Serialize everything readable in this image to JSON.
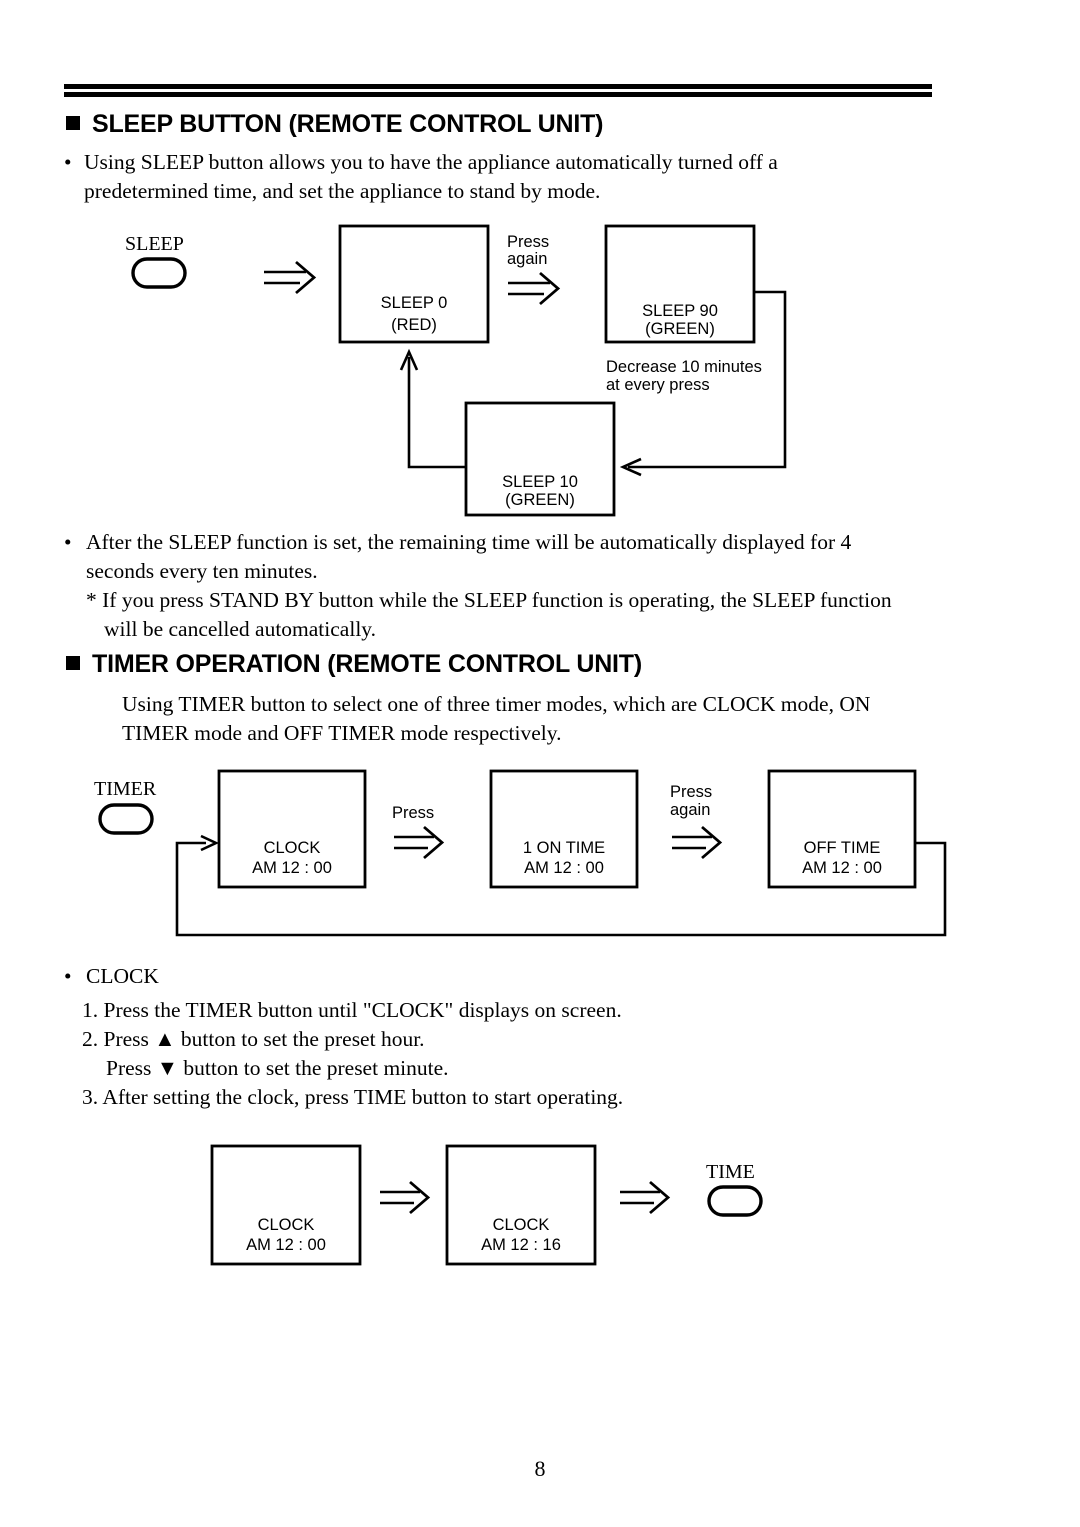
{
  "document": {
    "page_number": "8"
  },
  "sections": [
    {
      "heading": "SLEEP BUTTON (REMOTE CONTROL UNIT)",
      "paragraphs": [
        {
          "bullet": "•",
          "lines": [
            "Using SLEEP button allows you to have the appliance automatically turned off a",
            "predetermined time, and set the appliance to stand by mode."
          ]
        }
      ]
    },
    {
      "heading": "TIMER OPERATION (REMOTE CONTROL UNIT)",
      "paragraphs": [
        {
          "bullet": "",
          "lines": [
            "Using TIMER button to select one of three timer modes, which are CLOCK mode, ON",
            "TIMER mode and OFF TIMER mode respectively."
          ]
        }
      ]
    }
  ],
  "sleep_notes": {
    "bullet": "•",
    "lines": [
      "After the SLEEP function is set, the remaining time will be automatically displayed for 4",
      "seconds every ten minutes."
    ],
    "note_lines": [
      "* If you press STAND BY button while  the SLEEP function is operating, the SLEEP function",
      "will be cancelled automatically."
    ]
  },
  "clock_instructions": {
    "bullet": "•",
    "title": "CLOCK",
    "steps": [
      "1. Press the TIMER button until \"CLOCK\" displays on screen.",
      "2. Press ▲ button to set the preset hour.",
      "Press ▼ button to set the preset minute.",
      "3. After setting the clock, press TIME button to start operating."
    ]
  },
  "sleep_diagram": {
    "button_label": "SLEEP",
    "boxes": [
      {
        "line1": "SLEEP 0",
        "line2": "(RED)"
      },
      {
        "line1": "SLEEP 90",
        "line2": "(GREEN)"
      },
      {
        "line1": "SLEEP 10",
        "line2": "(GREEN)"
      }
    ],
    "arrow_labels": [
      {
        "line1": "Press",
        "line2": "again"
      }
    ],
    "loop_note": {
      "line1": "Decrease 10 minutes",
      "line2": "at every press"
    }
  },
  "timer_diagram": {
    "button_label": "TIMER",
    "boxes": [
      {
        "line1": "CLOCK",
        "line2": "AM 12 : 00"
      },
      {
        "line1": "1 ON TIME",
        "line2": "AM 12 : 00"
      },
      {
        "line1": "OFF TIME",
        "line2": "AM 12 : 00"
      }
    ],
    "arrow_labels": [
      {
        "line1": "Press",
        "line2": ""
      },
      {
        "line1": "Press",
        "line2": "again"
      }
    ]
  },
  "clock_set_diagram": {
    "boxes": [
      {
        "line1": "CLOCK",
        "line2": "AM 12 : 00"
      },
      {
        "line1": "CLOCK",
        "line2": "AM 12 : 16"
      }
    ],
    "button_label": "TIME"
  }
}
